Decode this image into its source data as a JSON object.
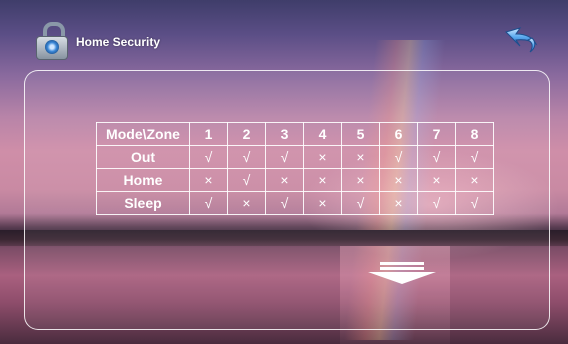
{
  "header": {
    "title": "Home Security",
    "icon": "lock-icon",
    "back_icon": "back-arrow-icon"
  },
  "table": {
    "corner_label": "Mode\\Zone",
    "zones": [
      "1",
      "2",
      "3",
      "4",
      "5",
      "6",
      "7",
      "8"
    ],
    "rows": [
      {
        "mode": "Out",
        "marks": [
          "√",
          "√",
          "√",
          "×",
          "×",
          "√",
          "√",
          "√"
        ]
      },
      {
        "mode": "Home",
        "marks": [
          "×",
          "√",
          "×",
          "×",
          "×",
          "×",
          "×",
          "×"
        ]
      },
      {
        "mode": "Sleep",
        "marks": [
          "√",
          "×",
          "√",
          "×",
          "√",
          "×",
          "√",
          "√"
        ]
      }
    ]
  },
  "footer": {
    "scroll_icon": "scroll-down-arrow-icon"
  }
}
